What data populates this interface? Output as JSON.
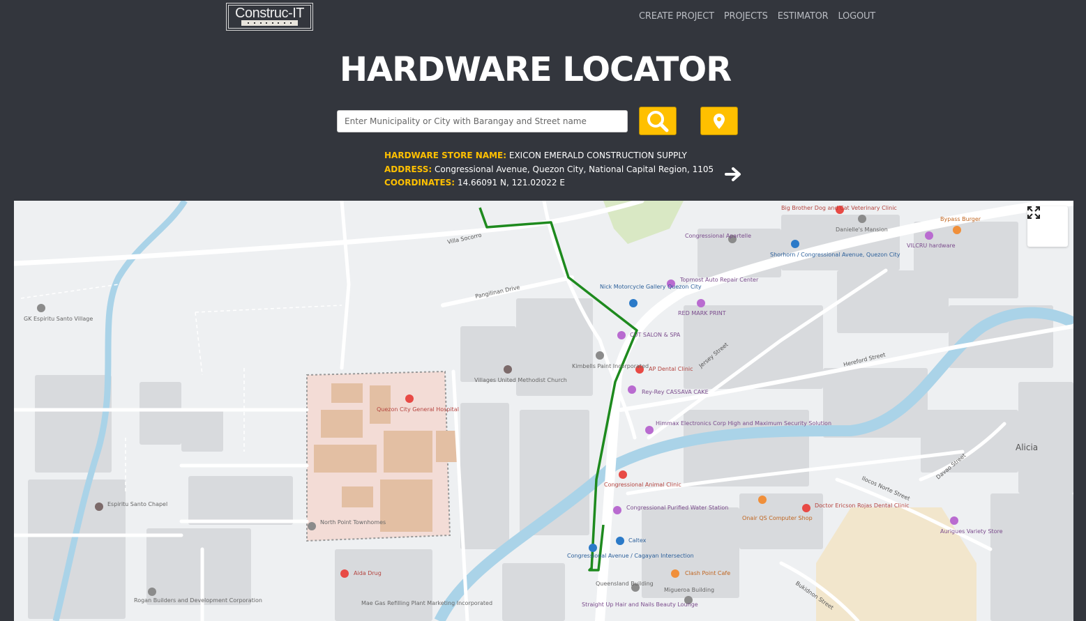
{
  "logo": {
    "text": "Construc-IT"
  },
  "nav": {
    "items": [
      "CREATE PROJECT",
      "PROJECTS",
      "ESTIMATOR",
      "LOGOUT"
    ]
  },
  "page_title": "HARDWARE LOCATOR",
  "search": {
    "placeholder": "Enter Municipality or City with Barangay and Street name",
    "value": ""
  },
  "icons": {
    "search": "search-icon",
    "locate": "map-pin-icon",
    "next": "arrow-right-icon",
    "fullscreen": "expand-icon"
  },
  "colors": {
    "accent": "#ffc000",
    "background": "#33363d",
    "route": "#1e8a1e"
  },
  "store": {
    "name_label": "HARDWARE STORE NAME:",
    "name": "EXICON EMERALD CONSTRUCTION SUPPLY",
    "address_label": "ADDRESS:",
    "address": "Congressional Avenue, Quezon City, National Capital Region, 1105",
    "coords_label": "COORDINATES:",
    "coords": "14.66091 N, 121.02022 E"
  },
  "map": {
    "streets": [
      "Villa Socorro",
      "Pangilinan Drive",
      "Jersey Street",
      "Hereford Street",
      "Davao Street",
      "Ilocos Norte Street",
      "Bukidnon Street"
    ],
    "area_label": "Alicia",
    "places": [
      "GK Espiritu Santo Village",
      "Quezon City General Hospital",
      "Villages United Methodist Church",
      "Kimbells Paint Incorporated",
      "Nick Motorcycle Gallery Quezon City",
      "Topmost Auto Repair Center",
      "RED MARK PRINT",
      "CUT SALON & SPA",
      "AP Dental Clinic",
      "Rey-Rey CASSAVA CAKE",
      "Himmax Electronics Corp High and Maximum Security Solution",
      "Congressional Animal Clinic",
      "Congressional Purified Water Station",
      "Caltex",
      "Congressional Avenue / Cagayan Intersection",
      "Queensland Building",
      "Straight Up Hair and Nails Beauty Lounge",
      "Clash Point Cafe",
      "Migueroa Building",
      "Onair QS Computer Shop",
      "Doctor Ericson Rojas Dental Clinic",
      "Aurigues Variety Store",
      "Aida Drug",
      "Mae Gas Refilling Plant Marketing Incorporated",
      "Rogan Builders and Development Corporation",
      "Espiritu Santo Chapel",
      "North Point Townhomes",
      "Congressional Apartelle",
      "Big Brother Dog and Cat Veterinary Clinic",
      "Danielle's Mansion",
      "Shorhorn / Congressional Avenue, Quezon City",
      "Bypass Burger",
      "VILCRU hardware"
    ]
  }
}
